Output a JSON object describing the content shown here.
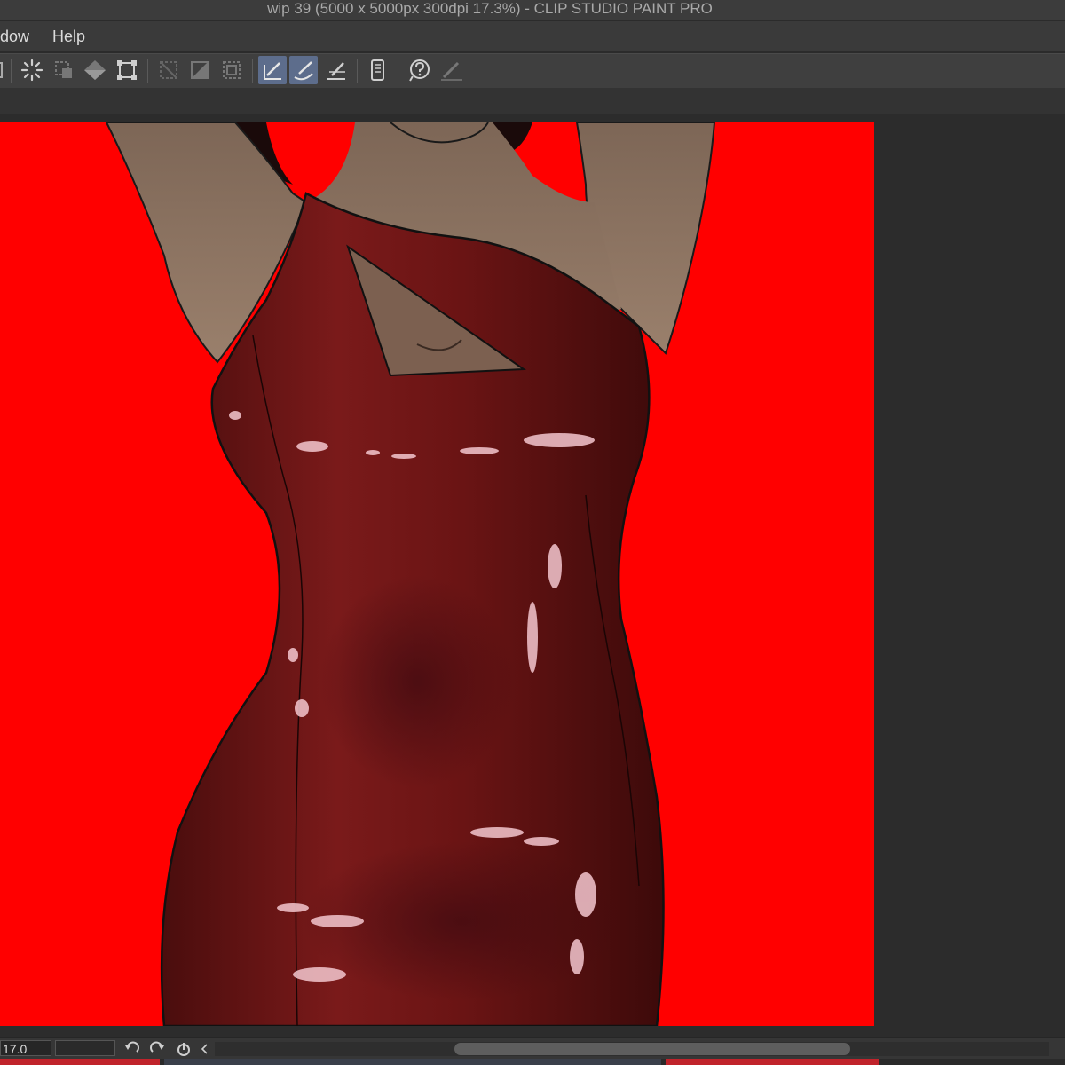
{
  "window": {
    "title": "wip 39 (5000 x 5000px 300dpi 17.3%)  - CLIP STUDIO PAINT PRO"
  },
  "menu": {
    "items": [
      {
        "label": "dow"
      },
      {
        "label": "Help"
      }
    ]
  },
  "toolbar": {
    "buttons": [
      {
        "icon": "partial-tool-icon"
      },
      {
        "icon": "loading-spinner-icon"
      },
      {
        "icon": "select-layer-icon"
      },
      {
        "icon": "fill-diamond-icon"
      },
      {
        "icon": "transform-icon"
      },
      {
        "icon": "clear-outside-icon"
      },
      {
        "icon": "fill-selection-icon"
      },
      {
        "icon": "selection-border-icon"
      },
      {
        "icon": "ruler-snap-icon",
        "active": true
      },
      {
        "icon": "special-ruler-snap-icon",
        "active": true
      },
      {
        "icon": "grid-snap-icon"
      },
      {
        "icon": "tablet-icon"
      },
      {
        "icon": "help-icon"
      },
      {
        "icon": "pen-pressure-icon"
      }
    ]
  },
  "statusbar": {
    "zoom_value": "17.0"
  },
  "colors": {
    "canvas_background": "#ff0000",
    "dress": "#6e1616",
    "skin": "#8a7260",
    "active_button": "#5d6d8c"
  }
}
